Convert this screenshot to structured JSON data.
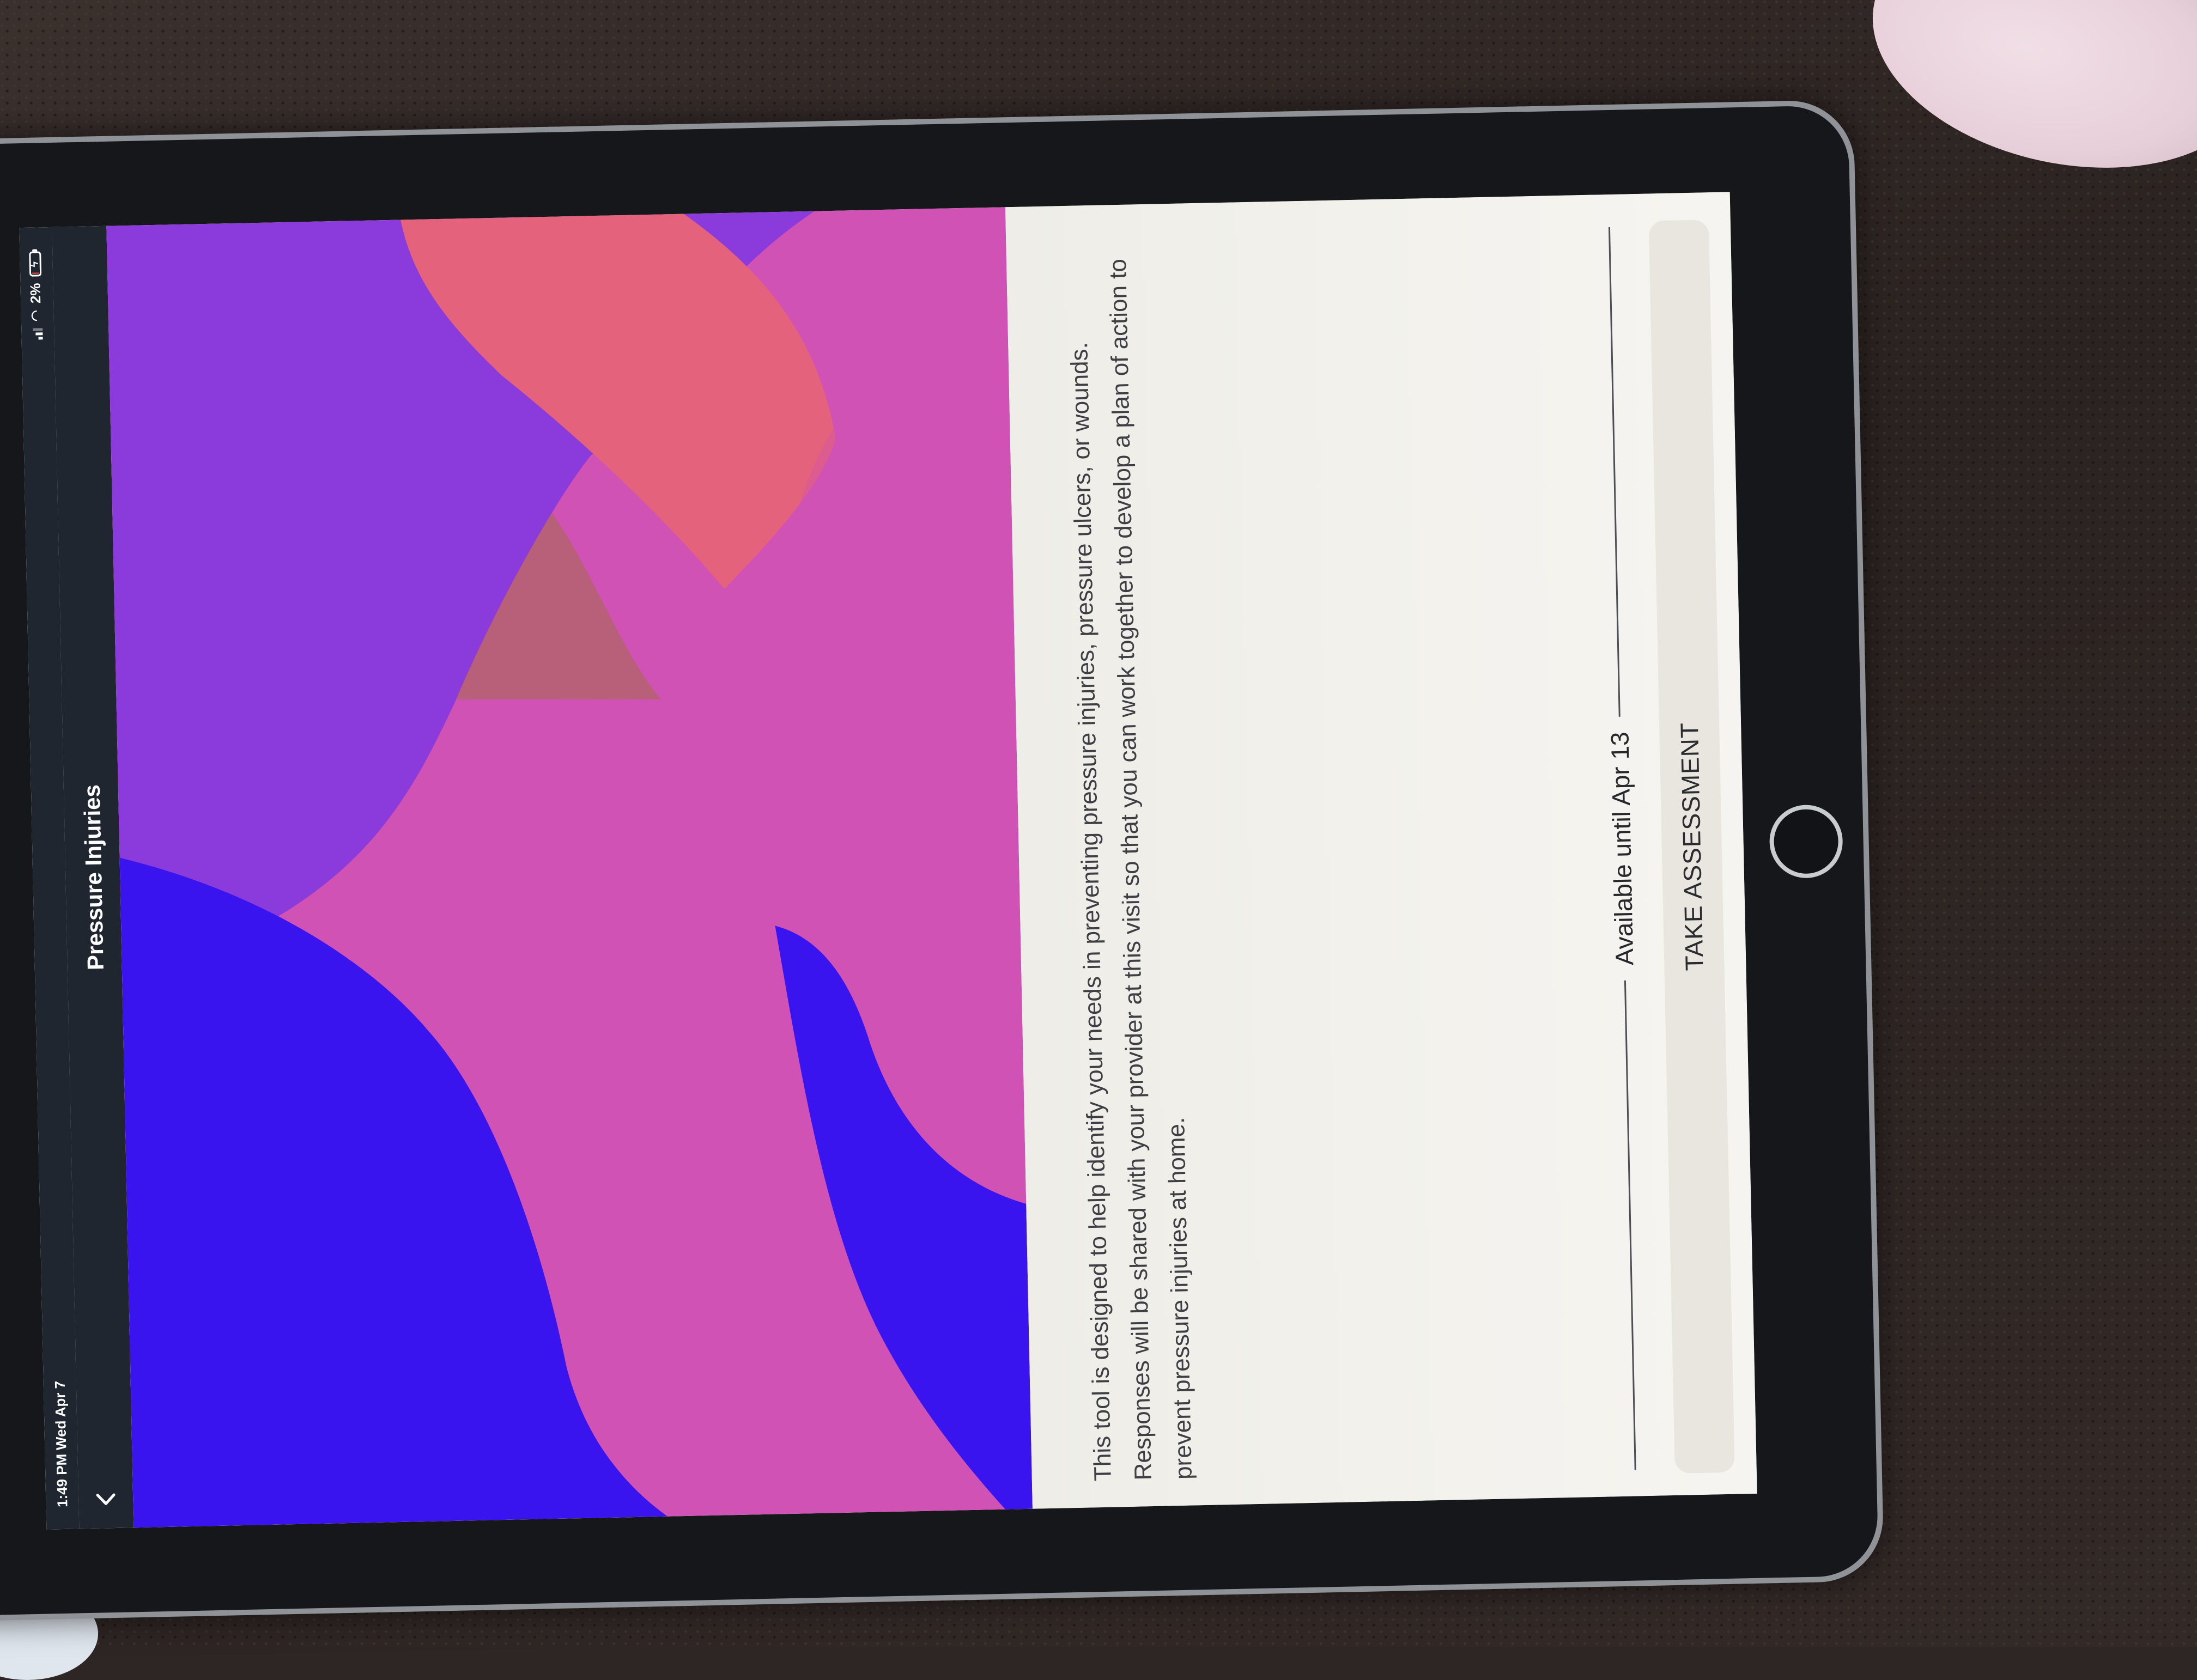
{
  "status_bar": {
    "time": "1:49 PM",
    "date": "Wed Apr 7",
    "battery": "2%",
    "icons": [
      "cellular-signal-icon",
      "wifi-icon",
      "battery-charging-icon"
    ]
  },
  "nav": {
    "back_icon": "chevron-left-icon",
    "title": "Pressure Injuries"
  },
  "hero": {
    "colors": {
      "magenta": "#cf52b4",
      "blue": "#3a14ef",
      "purple": "#8b3adb",
      "coral": "#e4627c",
      "mauve": "#b8607a"
    }
  },
  "content": {
    "description": "This tool is designed to help identify your needs in preventing pressure injuries, pressure ulcers, or wounds. Responses will be shared with your provider at this visit so that you can work together to develop a plan of action to prevent pressure injuries at home.",
    "availability": "Available until Apr 13",
    "button_label": "TAKE ASSESSMENT"
  }
}
